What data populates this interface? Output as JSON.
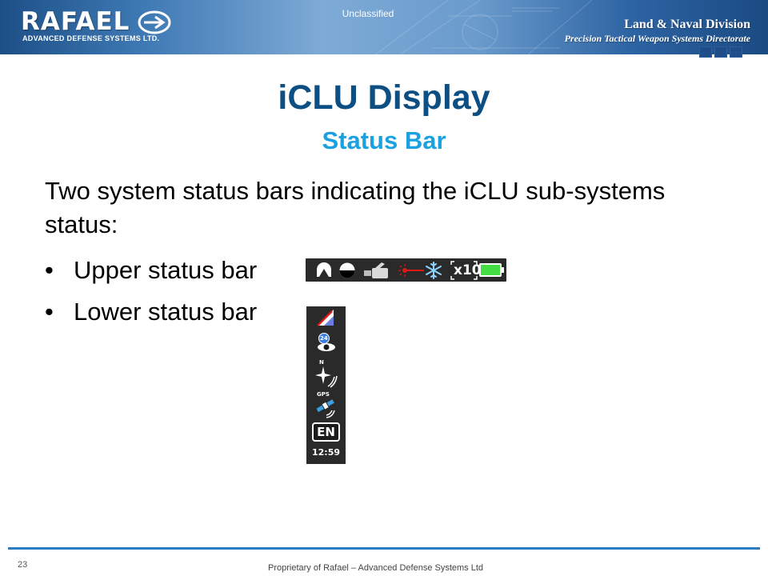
{
  "header": {
    "logo_word": "RAFAEL",
    "logo_subtitle": "ADVANCED DEFENSE SYSTEMS LTD.",
    "classification": "Unclassified",
    "division": "Land & Naval Division",
    "directorate": "Precision Tactical Weapon Systems Directorate"
  },
  "slide": {
    "title": "iCLU Display",
    "subtitle": "Status Bar",
    "intro": "Two system status bars indicating the iCLU sub-systems status:",
    "bullets": [
      {
        "marker": "•",
        "text": "Upper status bar"
      },
      {
        "marker": "•",
        "text": "Lower status bar"
      }
    ]
  },
  "upper_status_bar": {
    "icons": [
      "mode-icon",
      "day-night-icon",
      "camera-icon",
      "laser-icon",
      "cooler-icon",
      "zoom-icon",
      "battery-icon"
    ],
    "zoom_label": "x10",
    "battery_color": "#44dd44"
  },
  "lower_status_bar": {
    "icons": [
      "inclination-icon",
      "target-count-icon",
      "compass-icon",
      "gps-icon",
      "language-icon"
    ],
    "target_count": "24",
    "compass_label": "N",
    "gps_label": "GPS",
    "language": "EN",
    "time": "12:59"
  },
  "footer": {
    "page_number": "23",
    "text": "Proprietary of Rafael – Advanced Defense Systems Ltd"
  },
  "colors": {
    "title": "#0d4f82",
    "subtitle": "#1ba0e0",
    "footer_line": "#2c7cc1",
    "status_bar_bg": "#2a2a2a"
  }
}
